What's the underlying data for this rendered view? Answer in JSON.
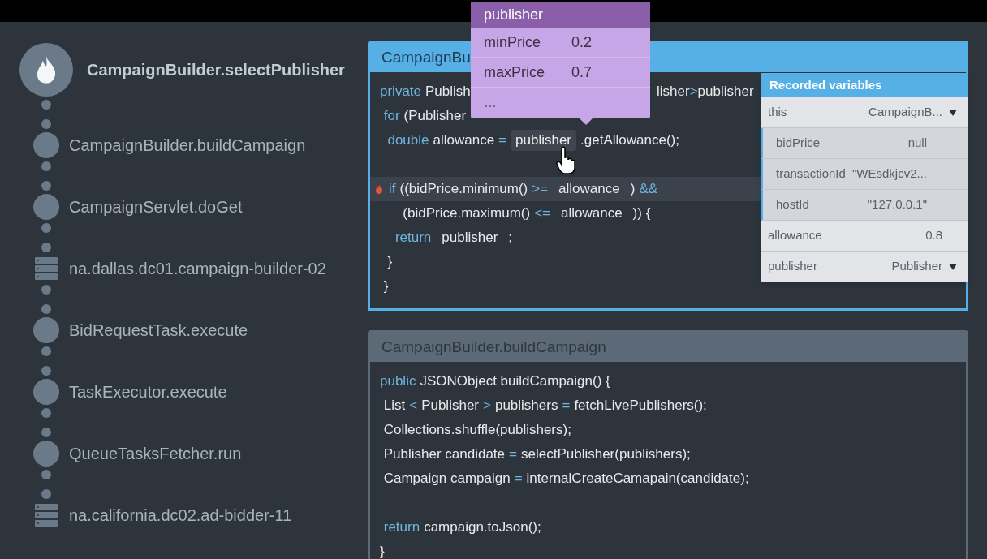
{
  "trace": [
    {
      "kind": "method",
      "label": "CampaignBuilder.selectPublisher",
      "selected": true
    },
    {
      "kind": "method",
      "label": "CampaignBuilder.buildCampaign",
      "selected": false
    },
    {
      "kind": "method",
      "label": "CampaignServlet.doGet",
      "selected": false
    },
    {
      "kind": "host",
      "label": "na.dallas.dc01.campaign-builder-02",
      "selected": false
    },
    {
      "kind": "method",
      "label": "BidRequestTask.execute",
      "selected": false
    },
    {
      "kind": "method",
      "label": "TaskExecutor.execute",
      "selected": false
    },
    {
      "kind": "method",
      "label": "QueueTasksFetcher.run",
      "selected": false
    },
    {
      "kind": "host",
      "label": "na.california.dc02.ad-bidder-11",
      "selected": false
    }
  ],
  "cards": [
    {
      "title": "CampaignBu",
      "active": true,
      "lines": [
        {
          "kind": "split",
          "left": [
            {
              "kind": "kw",
              "text": "private"
            },
            {
              "kind": "plain",
              "text": "Publish"
            }
          ],
          "right": [
            {
              "kind": "plain",
              "text": "lisher"
            },
            {
              "kind": "op",
              "text": ">"
            },
            {
              "kind": "plain",
              "text": "publisher"
            }
          ]
        },
        {
          "kind": "split",
          "left": [
            {
              "kind": "kw",
              "text": " for"
            },
            {
              "kind": "plain",
              "text": "(Publisher"
            }
          ]
        },
        {
          "kind": "code",
          "tokens": [
            {
              "kind": "kw",
              "text": "  double"
            },
            {
              "kind": "plain",
              "text": "allowance"
            },
            {
              "kind": "op",
              "text": "="
            },
            {
              "kind": "hover",
              "text": "publisher"
            },
            {
              "kind": "plain",
              "text": ".getAllowance();"
            }
          ]
        },
        {
          "kind": "blank"
        },
        {
          "kind": "breakpoint",
          "tokens": [
            {
              "kind": "kw",
              "text": "if"
            },
            {
              "kind": "plain",
              "text": "((bidPrice.minimum()"
            },
            {
              "kind": "op",
              "text": ">="
            },
            {
              "kind": "var",
              "text": "allowance"
            },
            {
              "kind": "plain",
              "text": ")"
            },
            {
              "kind": "op",
              "text": "&&"
            }
          ]
        },
        {
          "kind": "code",
          "tokens": [
            {
              "kind": "plain",
              "text": "      (bidPrice.maximum()"
            },
            {
              "kind": "op",
              "text": "<="
            },
            {
              "kind": "var",
              "text": "allowance"
            },
            {
              "kind": "plain",
              "text": ")) {"
            }
          ]
        },
        {
          "kind": "code",
          "tokens": [
            {
              "kind": "kw",
              "text": "    return"
            },
            {
              "kind": "var",
              "text": "publisher"
            },
            {
              "kind": "plain",
              "text": ";"
            }
          ]
        },
        {
          "kind": "code",
          "tokens": [
            {
              "kind": "plain",
              "text": "  }"
            }
          ]
        },
        {
          "kind": "code",
          "tokens": [
            {
              "kind": "plain",
              "text": " }"
            }
          ]
        }
      ]
    },
    {
      "title": "CampaignBuilder.buildCampaign",
      "active": false,
      "lines": [
        {
          "kind": "code",
          "tokens": [
            {
              "kind": "kw",
              "text": "public"
            },
            {
              "kind": "plain",
              "text": "JSONObject buildCampaign() {"
            }
          ]
        },
        {
          "kind": "code",
          "tokens": [
            {
              "kind": "plain",
              "text": " List"
            },
            {
              "kind": "op",
              "text": "<"
            },
            {
              "kind": "plain",
              "text": "Publisher"
            },
            {
              "kind": "op",
              "text": ">"
            },
            {
              "kind": "plain",
              "text": "publishers"
            },
            {
              "kind": "op",
              "text": "="
            },
            {
              "kind": "plain",
              "text": "fetchLivePublishers();"
            }
          ]
        },
        {
          "kind": "code",
          "tokens": [
            {
              "kind": "plain",
              "text": " Collections.shuffle(publishers);"
            }
          ]
        },
        {
          "kind": "code",
          "tokens": [
            {
              "kind": "plain",
              "text": " Publisher candidate"
            },
            {
              "kind": "op",
              "text": "="
            },
            {
              "kind": "plain",
              "text": "selectPublisher(publishers);"
            }
          ]
        },
        {
          "kind": "code",
          "tokens": [
            {
              "kind": "plain",
              "text": " Campaign campaign"
            },
            {
              "kind": "op",
              "text": "="
            },
            {
              "kind": "plain",
              "text": "internalCreateCamapain(candidate);"
            }
          ]
        },
        {
          "kind": "blank"
        },
        {
          "kind": "code",
          "tokens": [
            {
              "kind": "kw",
              "text": " return"
            },
            {
              "kind": "plain",
              "text": "campaign.toJson();"
            }
          ]
        },
        {
          "kind": "code",
          "tokens": [
            {
              "kind": "plain",
              "text": "}"
            }
          ]
        }
      ]
    }
  ],
  "popup": {
    "title": "publisher",
    "rows": [
      {
        "name": "minPrice",
        "value": "0.2"
      },
      {
        "name": "maxPrice",
        "value": "0.7"
      }
    ],
    "more": "…"
  },
  "variables": {
    "title": "Recorded variables",
    "items": [
      {
        "name": "this",
        "value": "CampaignB...",
        "expandable": true,
        "children": [
          {
            "name": "bidPrice",
            "value": "null",
            "expandable": false
          },
          {
            "name": "transactionId",
            "value": "\"WEsdkjcv2...",
            "expandable": false
          },
          {
            "name": "hostId",
            "value": "\"127.0.0.1\"",
            "expandable": false
          }
        ]
      },
      {
        "name": "allowance",
        "value": "0.8",
        "expandable": false
      },
      {
        "name": "publisher",
        "value": "Publisher",
        "expandable": true
      }
    ]
  }
}
